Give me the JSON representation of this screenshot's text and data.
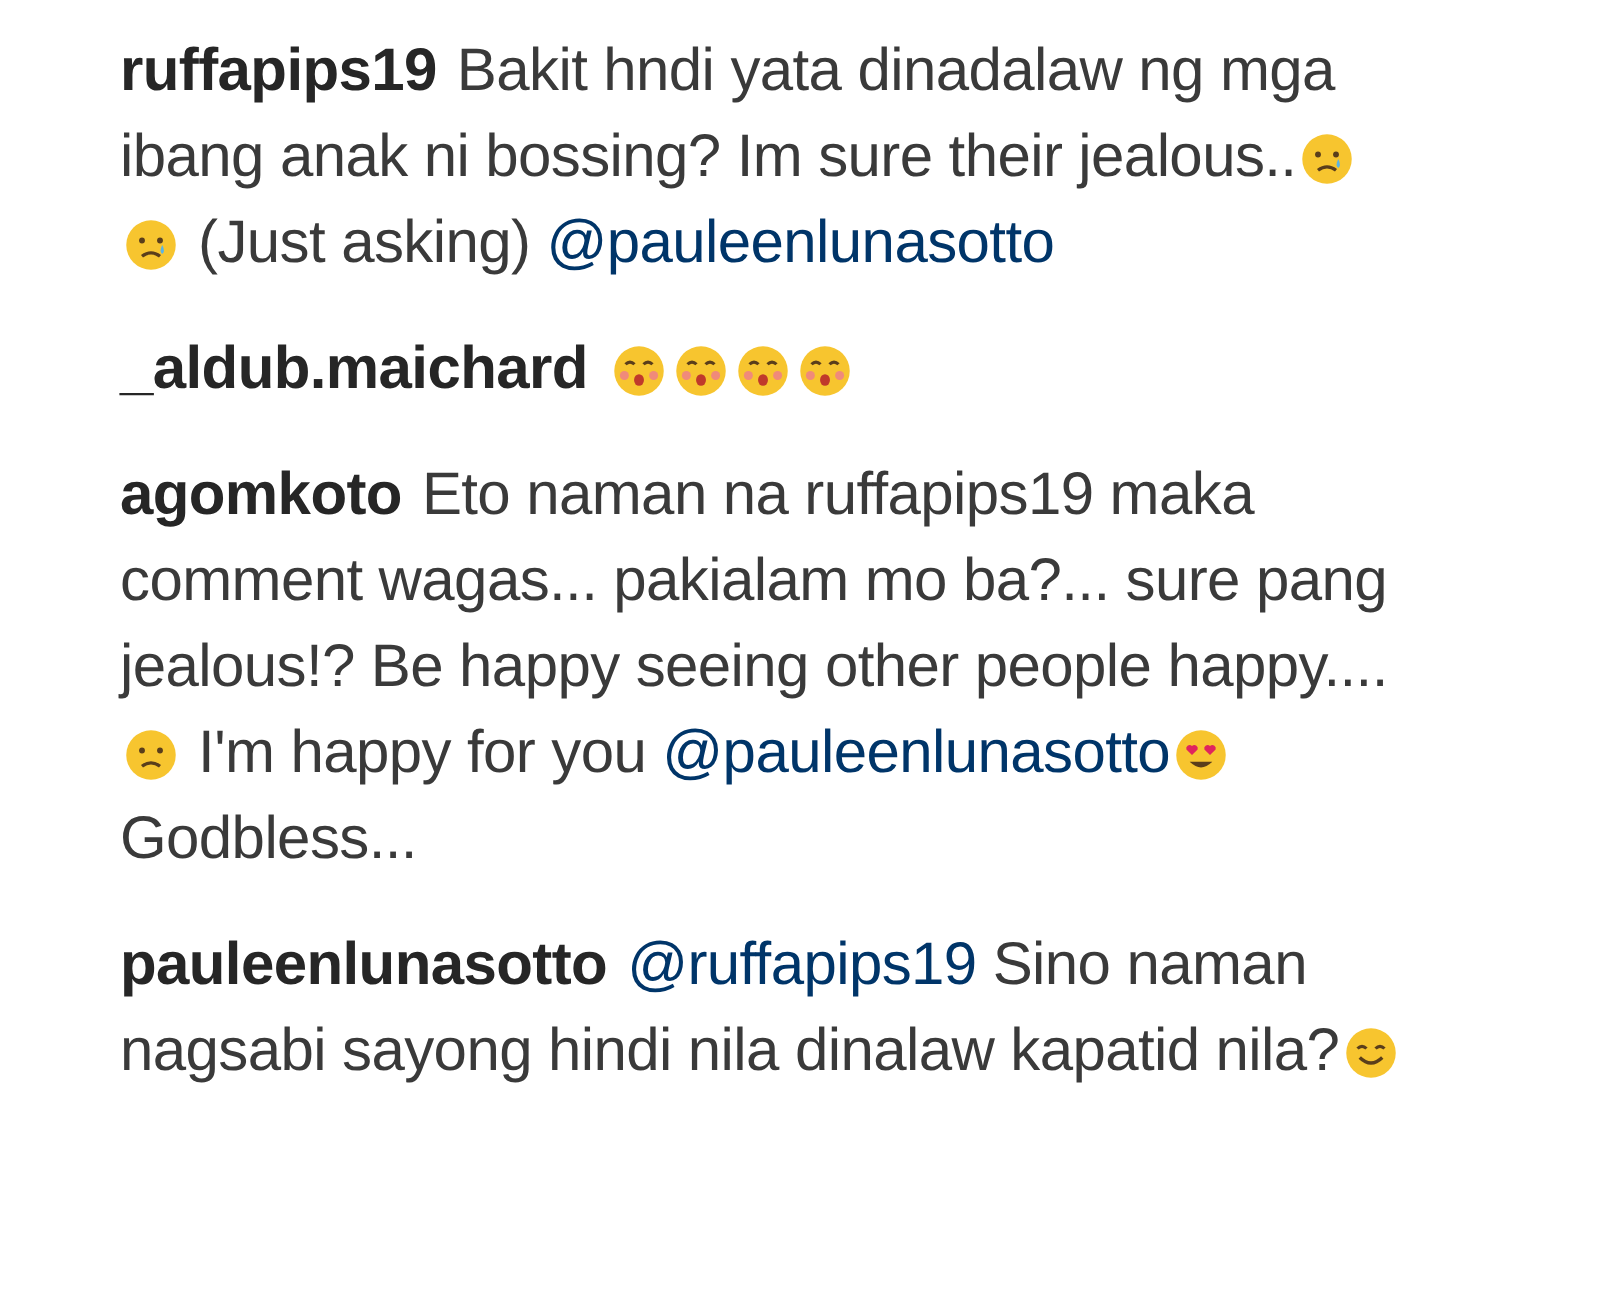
{
  "comments": [
    {
      "username": "ruffapips19",
      "segments": [
        {
          "kind": "text",
          "text": "Bakit hndi yata dinadalaw ng mga ibang anak ni bossing? Im sure their jealous.."
        },
        {
          "kind": "emoji-crying"
        },
        {
          "kind": "emoji-crying"
        },
        {
          "kind": "text",
          "text": " (Just asking) "
        },
        {
          "kind": "mention",
          "text": "@pauleenlunasotto"
        }
      ]
    },
    {
      "username": "_aldub.maichard",
      "segments": [
        {
          "kind": "emoji-surprised"
        },
        {
          "kind": "emoji-surprised"
        },
        {
          "kind": "emoji-surprised"
        },
        {
          "kind": "emoji-surprised"
        }
      ]
    },
    {
      "username": "agomkoto",
      "segments": [
        {
          "kind": "text",
          "text": "Eto naman na ruffapips19 maka comment wagas... pakialam mo ba?... sure pang jealous!? Be happy seeing other people happy.... "
        },
        {
          "kind": "emoji-sad"
        },
        {
          "kind": "text",
          "text": " I'm happy for you "
        },
        {
          "kind": "mention",
          "text": "@pauleenlunasotto"
        },
        {
          "kind": "emoji-heart-eyes"
        },
        {
          "kind": "text",
          "text": " Godbless..."
        }
      ]
    },
    {
      "username": "pauleenlunasotto",
      "segments": [
        {
          "kind": "mention",
          "text": "@ruffapips19"
        },
        {
          "kind": "text",
          "text": " Sino naman nagsabi sayong hindi nila dinalaw kapatid nila?"
        },
        {
          "kind": "emoji-smiling"
        }
      ]
    }
  ]
}
